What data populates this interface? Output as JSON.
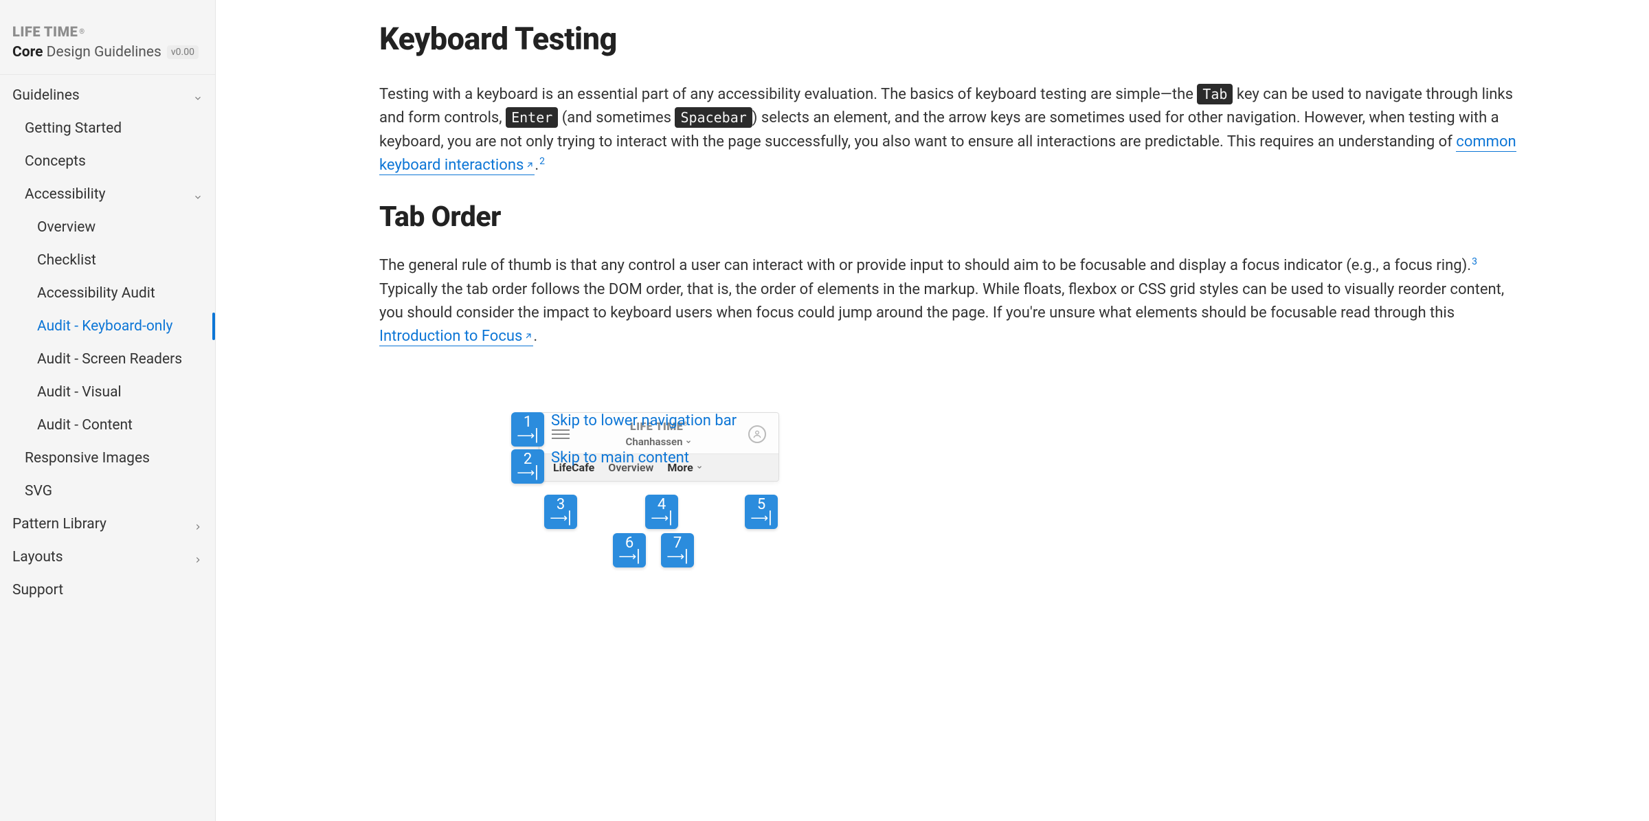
{
  "brand": {
    "logo_text": "LIFE TIME",
    "site_core": "Core",
    "site_rest": "Design Guidelines",
    "version": "v0.00"
  },
  "nav": {
    "guidelines": {
      "label": "Guidelines",
      "items": {
        "getting_started": "Getting Started",
        "concepts": "Concepts",
        "accessibility": {
          "label": "Accessibility",
          "items": {
            "overview": "Overview",
            "checklist": "Checklist",
            "audit": "Accessibility Audit",
            "audit_kbd": "Audit - Keyboard-only",
            "audit_sr": "Audit - Screen Readers",
            "audit_visual": "Audit - Visual",
            "audit_content": "Audit - Content"
          }
        },
        "responsive_images": "Responsive Images",
        "svg": "SVG"
      }
    },
    "pattern_library": "Pattern Library",
    "layouts": "Layouts",
    "support": "Support"
  },
  "content": {
    "h1": "Keyboard Testing",
    "p1a": "Testing with a keyboard is an essential part of any accessibility evaluation. The basics of keyboard testing are simple—the ",
    "kbd_tab": "Tab",
    "p1b": " key can be used to navigate through links and form controls, ",
    "kbd_enter": "Enter",
    "p1c": " (and sometimes ",
    "kbd_space": "Spacebar",
    "p1d": ") selects an element, and the arrow keys are sometimes used for other navigation. However, when testing with a keyboard, you are not only trying to interact with the page successfully, you also want to ensure all interactions are predictable. This requires an understanding of ",
    "link1": "common keyboard interactions",
    "fn1": "2",
    "h2": "Tab Order",
    "p2a": "The general rule of thumb is that any control a user can interact with or provide input to should aim to be focusable and display a focus indicator (e.g., a focus ring).",
    "fn2": "3",
    "p2b": " Typically the tab order follows the DOM order, that is, the order of elements in the markup. While floats, flexbox or CSS grid styles can be used to visually reorder content, you should consider the impact to keyboard users when focus could jump around the page. If you're unsure what elements should be focusable read through this ",
    "link2": "Introduction to Focus",
    "p2c": "."
  },
  "illus": {
    "skip1": "Skip to lower navigation bar",
    "skip2": "Skip to main content",
    "mock_logo": "LIFE TIME",
    "mock_sub": "Chanhassen",
    "tab1": "LifeCafe",
    "tab2": "Overview",
    "tab3": "More",
    "numbers": {
      "n1": "1",
      "n2": "2",
      "n3": "3",
      "n4": "4",
      "n5": "5",
      "n6": "6",
      "n7": "7"
    }
  }
}
